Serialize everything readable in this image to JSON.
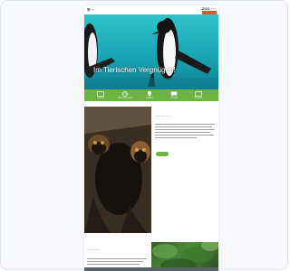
{
  "header": {
    "nav_label": "☰ ···",
    "logo_top": "ZOO · ···",
    "logo_accent": "#e2571e"
  },
  "hero": {
    "title": "Im Tierischen Vergnügen!"
  },
  "icon_bar": {
    "color": "#6db33f",
    "items": [
      {
        "icon": "ticket-icon",
        "label": "Tickets"
      },
      {
        "icon": "clock-icon",
        "label": "Öffnungszeiten"
      },
      {
        "icon": "map-pin-icon",
        "label": "Anfahrt"
      },
      {
        "icon": "chat-icon",
        "label": "Kontakt"
      },
      {
        "icon": "map-icon",
        "label": "Zooplan"
      }
    ]
  },
  "breadcrumb": "···",
  "info": {
    "title": "······ ····· ····",
    "subtitle": "····· ·······",
    "button": "····"
  },
  "lower": {
    "title": "····· ········",
    "subtitle": "········ ····"
  }
}
